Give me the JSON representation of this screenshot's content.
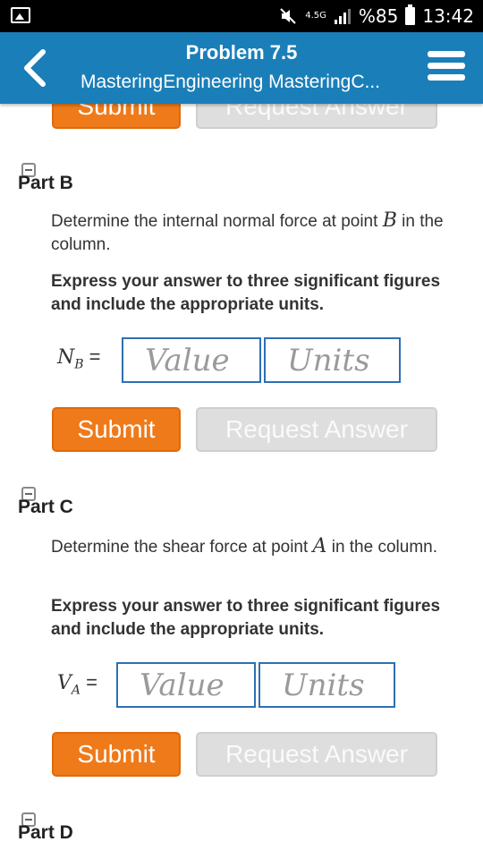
{
  "status_bar": {
    "network": "4.5G",
    "battery": "%85",
    "time": "13:42"
  },
  "app_bar": {
    "title": "Problem 7.5",
    "subtitle": "MasteringEngineering MasteringC..."
  },
  "prev_part": {
    "submit_label": "Submit",
    "request_label": "Request Answer"
  },
  "parts": [
    {
      "title": "Part B",
      "prompt_pre": "Determine the internal normal force at point ",
      "prompt_var": "B",
      "prompt_post": " in the column.",
      "instruction": "Express your answer to three significant figures and include the appropriate units.",
      "label_symbol": "N",
      "label_sub": "B",
      "label_eq": " =",
      "value_placeholder": "Value",
      "units_placeholder": "Units",
      "submit_label": "Submit",
      "request_label": "Request Answer"
    },
    {
      "title": "Part C",
      "prompt_pre": "Determine the shear force at point ",
      "prompt_var": "A",
      "prompt_post": " in the column.",
      "instruction": "Express your answer to three significant figures and include the appropriate units.",
      "label_symbol": "V",
      "label_sub": "A",
      "label_eq": " =",
      "value_placeholder": "Value",
      "units_placeholder": "Units",
      "submit_label": "Submit",
      "request_label": "Request Answer"
    },
    {
      "title": "Part D"
    }
  ]
}
